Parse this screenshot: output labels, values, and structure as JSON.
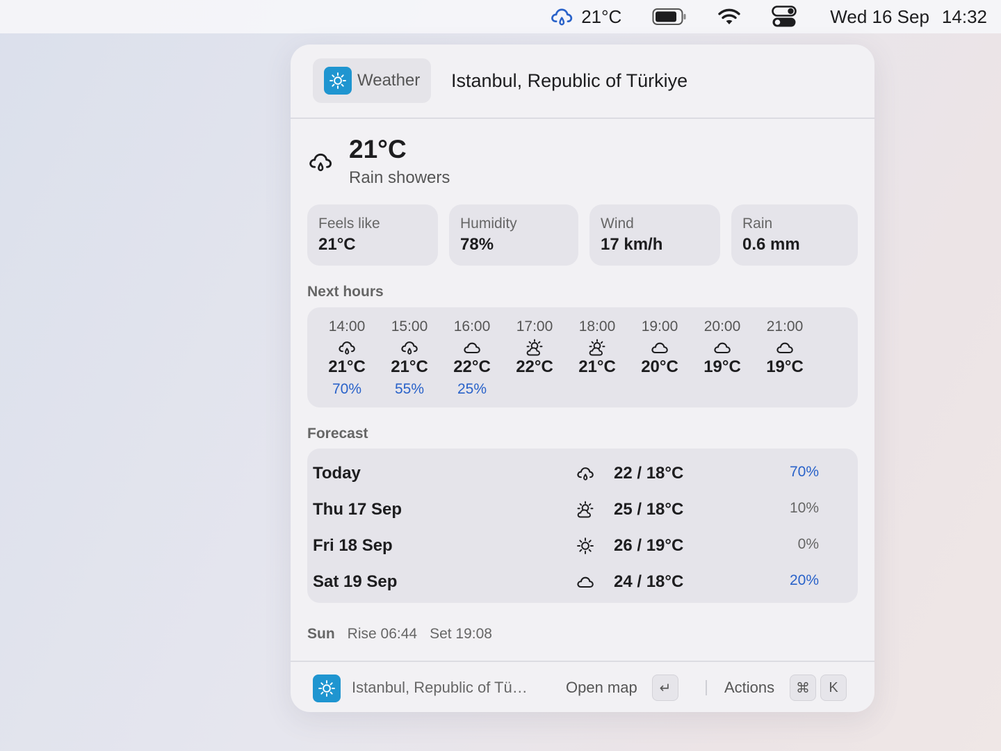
{
  "menubar": {
    "weather_temp": "21°C",
    "date": "Wed 16 Sep",
    "time": "14:32"
  },
  "header": {
    "app_label": "Weather",
    "location": "Istanbul, Republic of Türkiye"
  },
  "current": {
    "icon": "rain-showers-icon",
    "temperature": "21°C",
    "condition": "Rain showers"
  },
  "stats": [
    {
      "label": "Feels like",
      "value": "21°C"
    },
    {
      "label": "Humidity",
      "value": "78%"
    },
    {
      "label": "Wind",
      "value": "17 km/h"
    },
    {
      "label": "Rain",
      "value": "0.6 mm"
    }
  ],
  "hours_label": "Next hours",
  "hours": [
    {
      "time": "14:00",
      "icon": "rain",
      "temp": "21°C",
      "pop": "70%"
    },
    {
      "time": "15:00",
      "icon": "rain",
      "temp": "21°C",
      "pop": "55%"
    },
    {
      "time": "16:00",
      "icon": "cloud",
      "temp": "22°C",
      "pop": "25%"
    },
    {
      "time": "17:00",
      "icon": "partly",
      "temp": "22°C",
      "pop": ""
    },
    {
      "time": "18:00",
      "icon": "partly",
      "temp": "21°C",
      "pop": ""
    },
    {
      "time": "19:00",
      "icon": "cloud",
      "temp": "20°C",
      "pop": ""
    },
    {
      "time": "20:00",
      "icon": "cloud",
      "temp": "19°C",
      "pop": ""
    },
    {
      "time": "21:00",
      "icon": "cloud",
      "temp": "19°C",
      "pop": ""
    }
  ],
  "forecast_label": "Forecast",
  "forecast": [
    {
      "day": "Today",
      "icon": "rain",
      "temps": "22 / 18°C",
      "pop": "70%",
      "pop_highlight": true
    },
    {
      "day": "Thu 17 Sep",
      "icon": "partly",
      "temps": "25 / 18°C",
      "pop": "10%",
      "pop_highlight": false
    },
    {
      "day": "Fri 18 Sep",
      "icon": "sun",
      "temps": "26 / 19°C",
      "pop": "0%",
      "pop_highlight": false
    },
    {
      "day": "Sat 19 Sep",
      "icon": "cloud",
      "temps": "24 / 18°C",
      "pop": "20%",
      "pop_highlight": true
    }
  ],
  "sun": {
    "label": "Sun",
    "rise": "Rise 06:44",
    "set": "Set 19:08"
  },
  "footer": {
    "location": "Istanbul, Republic of Tü…",
    "open_map": "Open map",
    "enter_key": "↵",
    "actions": "Actions",
    "cmd_key": "⌘",
    "k_key": "K"
  },
  "colors": {
    "accent_blue": "#2962c9",
    "app_icon": "#1f95d0"
  }
}
